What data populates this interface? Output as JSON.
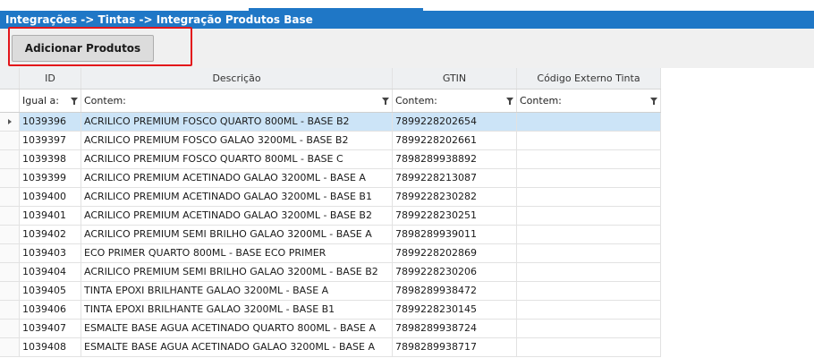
{
  "breadcrumb": "Integrações -> Tintas -> Integração Produtos Base",
  "toolbar": {
    "add_label": "Adicionar Produtos"
  },
  "columns": [
    "ID",
    "Descrição",
    "GTIN",
    "Código Externo Tinta"
  ],
  "filters": [
    "Igual a:",
    "Contem:",
    "Contem:",
    "Contem:"
  ],
  "rows": [
    [
      "1039396",
      "ACRILICO PREMIUM FOSCO QUARTO 800ML - BASE B2",
      "7899228202654",
      ""
    ],
    [
      "1039397",
      "ACRILICO PREMIUM FOSCO GALAO 3200ML - BASE B2",
      "7899228202661",
      ""
    ],
    [
      "1039398",
      "ACRILICO PREMIUM FOSCO QUARTO 800ML - BASE C",
      "7898289938892",
      ""
    ],
    [
      "1039399",
      "ACRILICO PREMIUM ACETINADO GALAO 3200ML - BASE A",
      "7899228213087",
      ""
    ],
    [
      "1039400",
      "ACRILICO PREMIUM ACETINADO GALAO 3200ML - BASE B1",
      "7899228230282",
      ""
    ],
    [
      "1039401",
      "ACRILICO PREMIUM ACETINADO GALAO 3200ML - BASE B2",
      "7899228230251",
      ""
    ],
    [
      "1039402",
      "ACRILICO PREMIUM SEMI BRILHO GALAO 3200ML - BASE A",
      "7898289939011",
      ""
    ],
    [
      "1039403",
      "ECO PRIMER QUARTO 800ML - BASE ECO PRIMER",
      "7899228202869",
      ""
    ],
    [
      "1039404",
      "ACRILICO PREMIUM SEMI BRILHO GALAO 3200ML - BASE B2",
      "7899228230206",
      ""
    ],
    [
      "1039405",
      "TINTA EPOXI BRILHANTE GALAO 3200ML - BASE A",
      "7898289938472",
      ""
    ],
    [
      "1039406",
      "TINTA EPOXI BRILHANTE GALAO 3200ML - BASE B1",
      "7899228230145",
      ""
    ],
    [
      "1039407",
      "ESMALTE BASE AGUA ACETINADO QUARTO 800ML - BASE A",
      "7898289938724",
      ""
    ],
    [
      "1039408",
      "ESMALTE BASE AGUA ACETINADO GALAO 3200ML - BASE A",
      "7898289938717",
      ""
    ]
  ],
  "selected_row": 0,
  "colors": {
    "accent": "#1f77c6",
    "highlight": "#e3151a",
    "selected": "#cce4f7"
  }
}
